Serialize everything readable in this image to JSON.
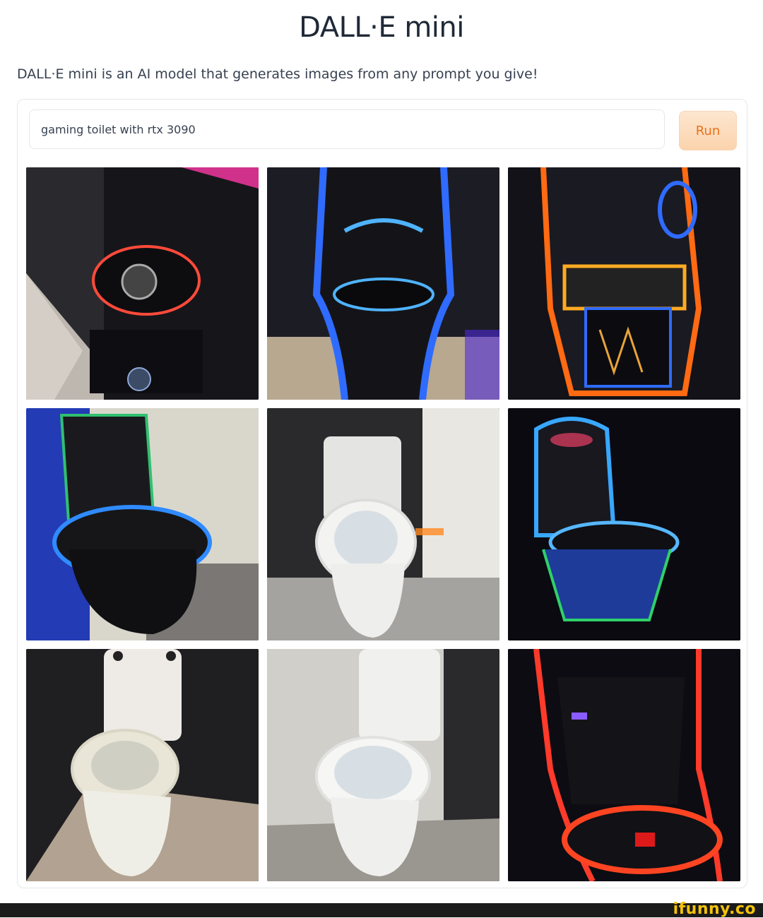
{
  "header": {
    "title": "DALL·E mini",
    "subtitle": "DALL·E mini is an AI model that generates images from any prompt you give!"
  },
  "prompt": {
    "value": "gaming toilet with rtx 3090",
    "run_label": "Run"
  },
  "results": [
    {
      "subject": "gaming toilet with fan and pink neon, top view"
    },
    {
      "subject": "gaming chair toilet with blue neon"
    },
    {
      "subject": "gaming toilet with orange and blue neon"
    },
    {
      "subject": "black toilet with blue neon trim"
    },
    {
      "subject": "white toilet in dark tiled bathroom"
    },
    {
      "subject": "gaming toilet with blue and green neon"
    },
    {
      "subject": "white toilet with open lid"
    },
    {
      "subject": "white toilet in corner"
    },
    {
      "subject": "gaming chair toilet with red neon"
    }
  ],
  "watermark": "ifunny.co",
  "colors": {
    "run_text": "#e8731a",
    "run_bg": "#fde6cf",
    "neon_blue": "#2f6bff",
    "neon_red": "#ff3a2a",
    "neon_pink": "#ff3aa8",
    "neon_orange": "#ff6a12"
  }
}
